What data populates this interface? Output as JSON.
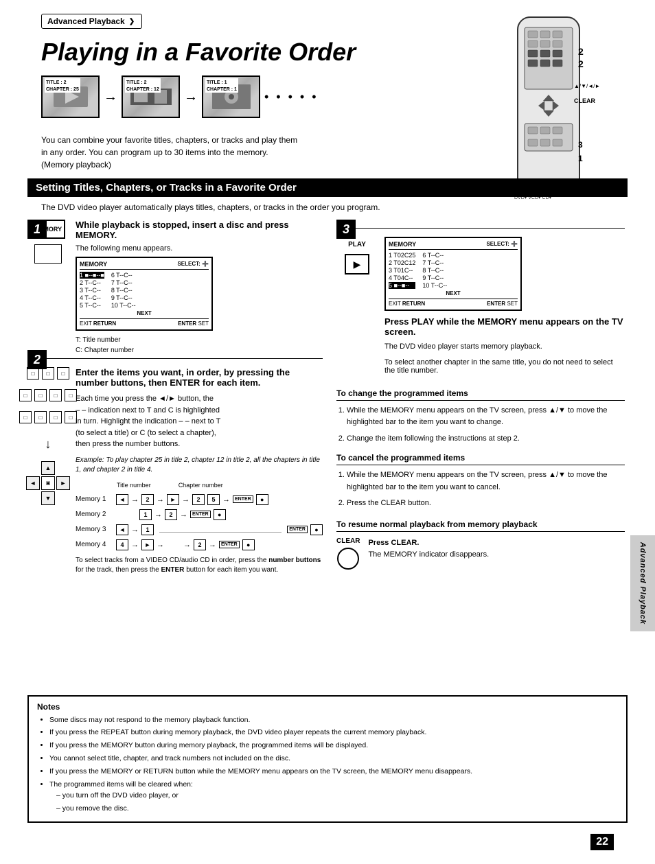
{
  "breadcrumb": "Advanced Playback",
  "main_title": "Playing in a Favorite Order",
  "section_header": "Setting Titles, Chapters, or Tracks in a Favorite Order",
  "sub_description": "The DVD video player automatically plays titles, chapters, or tracks in the order you program.",
  "description": {
    "line1": "You can combine your favorite titles, chapters, or tracks and play them",
    "line2": "in any order. You can program up to 30 items into the memory.",
    "line3": "(Memory playback)"
  },
  "sequence": {
    "items": [
      {
        "title": "TITLE : 2",
        "chapter": "CHAPTER : 25"
      },
      {
        "title": "TITLE : 2",
        "chapter": "CHAPTER : 12"
      },
      {
        "title": "TITLE : 1",
        "chapter": "CHAPTER : 1"
      }
    ],
    "dots": "• • • • •"
  },
  "step1": {
    "number": "1",
    "icon_label": "MEMORY",
    "heading": "While playback is stopped, insert a disc and press MEMORY.",
    "following_text": "The following menu appears.",
    "menu": {
      "header_left": "MEMORY",
      "header_right": "SELECT: ➕",
      "col1": [
        "1  ■--■--■",
        "2  T--C--",
        "3  T--C--",
        "4  T--C--",
        "5  T--C--"
      ],
      "col2": [
        "6  T--C--",
        "7  T--C--",
        "8  T--C--",
        "9  T--C--",
        "10 T--C--"
      ],
      "next": "NEXT",
      "footer_left": "EXIT RETURN",
      "footer_right": "ENTER SET"
    },
    "note_T": "T: Title number",
    "note_C": "C: Chapter number"
  },
  "step2": {
    "number": "2",
    "heading": "Enter the items you want, in order, by pressing the number buttons, then ENTER for each item.",
    "body_line1": "Each time you press the ◄/► button, the",
    "body_line2": "– – indication next to T and C is highlighted",
    "body_line3": "in turn. Highlight the indication – – next to T",
    "body_line4": "(to select a title) or C (to select a chapter),",
    "body_line5": "then press the number buttons.",
    "example_text": "Example: To play chapter 25 in title 2, chapter 12 in title 2, all the chapters in title 1, and chapter 2 in title 4.",
    "diagram_title_label": "Title number",
    "diagram_chapter_label": "Chapter number",
    "memories": [
      {
        "label": "Memory 1",
        "sequence": [
          "◄",
          "2",
          "►",
          "2",
          "5",
          "●"
        ]
      },
      {
        "label": "Memory 2",
        "sequence": [
          "1",
          "2",
          "●"
        ]
      },
      {
        "label": "Memory 3",
        "sequence": [
          "◄",
          "1",
          "●"
        ]
      },
      {
        "label": "Memory 4",
        "sequence": [
          "4",
          "►",
          "2",
          "●"
        ]
      }
    ],
    "tracks_note": "To select tracks from a VIDEO CD/audio CD in order, press the number buttons for the track, then press the ENTER button for each item you want."
  },
  "step3": {
    "number": "3",
    "icon_label": "PLAY",
    "heading": "Press PLAY while the MEMORY menu appears on the TV screen.",
    "body": "The DVD video player starts memory playback.",
    "menu": {
      "header_left": "MEMORY",
      "header_right": "SELECT: ➕",
      "col1": [
        "1  T02C25",
        "2  T02C12",
        "3  T01C--",
        "4  T04C--",
        "5  ■--■--"
      ],
      "col2": [
        "6  T--C--",
        "7  T--C--",
        "8  T--C--",
        "9  T--C--",
        "10 T--C--"
      ],
      "next": "NEXT",
      "footer_left": "EXIT RETURN",
      "footer_right": "ENTER SET"
    },
    "note": "To select another chapter in the same title, you do not need to select the title number."
  },
  "change_section": {
    "title": "To change the programmed items",
    "items": [
      "While the MEMORY menu appears on the TV screen, press ▲/▼ to move the highlighted bar to the item you want to change.",
      "Change the item following the instructions at step 2."
    ]
  },
  "cancel_section": {
    "title": "To cancel the programmed items",
    "items": [
      "While the MEMORY menu appears on the TV screen, press ▲/▼ to move the highlighted bar to the item you want to cancel.",
      "Press the CLEAR button."
    ]
  },
  "resume_section": {
    "title": "To resume normal playback from memory playback",
    "clear_label": "CLEAR",
    "instruction": "Press CLEAR.",
    "note": "The MEMORY indicator disappears."
  },
  "notes": {
    "title": "Notes",
    "items": [
      "Some discs may not respond to the memory playback function.",
      "If you press the REPEAT button during memory playback, the DVD video player repeats the current memory playback.",
      "If you press the MEMORY button during memory playback, the programmed items will be displayed.",
      "You cannot select title, chapter, and track numbers not included on the disc.",
      "If you press the MEMORY or RETURN button while the MEMORY menu appears on the TV screen, the MEMORY menu disappears.",
      "The programmed items will be cleared when:"
    ],
    "sub_items": [
      "you turn off the DVD video player, or",
      "you remove the disc."
    ]
  },
  "page_number": "22",
  "side_tab_text": "Advanced Playback",
  "remote_labels": {
    "num2_top": "2",
    "num2_bottom": "2",
    "clear_label": "CLEAR",
    "num3": "3",
    "num1": "1",
    "nav_label": "▲/▼/◄/►",
    "format_label": "DVD VCD CD"
  }
}
